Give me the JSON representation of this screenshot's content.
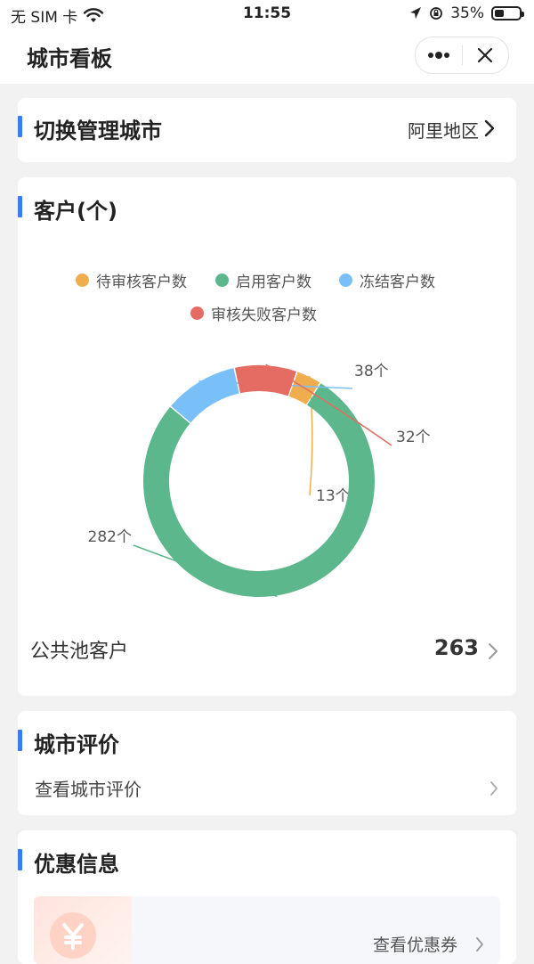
{
  "status_bar": {
    "carrier": "无 SIM 卡",
    "time": "11:55",
    "battery": "35%"
  },
  "nav": {
    "title": "城市看板",
    "more_icon": "more-dots-icon",
    "close_icon": "close-icon"
  },
  "city_switch": {
    "title": "切换管理城市",
    "value": "阿里地区"
  },
  "customers": {
    "title": "客户(个)",
    "legend": [
      {
        "label": "待审核客户数",
        "color": "#f0ad4e"
      },
      {
        "label": "启用客户数",
        "color": "#5cb88c"
      },
      {
        "label": "冻结客户数",
        "color": "#7ac0f8"
      },
      {
        "label": "审核失败客户数",
        "color": "#e46c62"
      }
    ],
    "public_pool_label": "公共池客户",
    "public_pool_value": "263"
  },
  "chart_data": {
    "type": "pie",
    "donut": true,
    "categories": [
      "待审核客户数",
      "启用客户数",
      "冻结客户数",
      "审核失败客户数"
    ],
    "values": [
      13,
      282,
      38,
      32
    ],
    "colors": [
      "#f0ad4e",
      "#5cb88c",
      "#7ac0f8",
      "#e46c62"
    ],
    "labels": [
      "13个",
      "282个",
      "38个",
      "32个"
    ],
    "legend_position": "top"
  },
  "city_rating": {
    "title": "城市评价",
    "link": "查看城市评价"
  },
  "promotions": {
    "title": "优惠信息",
    "link": "查看优惠券"
  }
}
